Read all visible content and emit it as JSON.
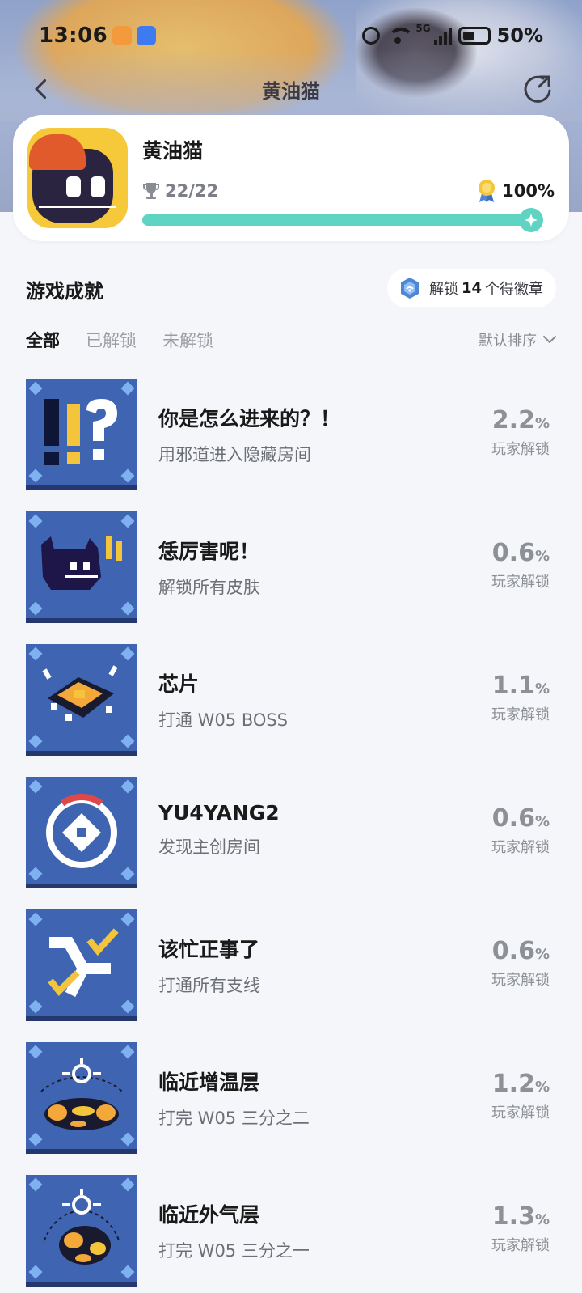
{
  "status": {
    "time": "13:06",
    "network": "5G",
    "battery": "50%"
  },
  "nav": {
    "title": "黄油猫"
  },
  "game": {
    "name": "黄油猫",
    "trophy_count": "22/22",
    "completion": "100%",
    "progress": 1.0
  },
  "section": {
    "title": "游戏成就",
    "unlock_prefix": "解锁",
    "unlock_count": "14",
    "unlock_suffix": "个得徽章"
  },
  "filters": {
    "tabs": [
      "全部",
      "已解锁",
      "未解锁"
    ],
    "active": 0,
    "sort_label": "默认排序"
  },
  "achievements": [
    {
      "title": "你是怎么进来的？！",
      "desc": "用邪道进入隐藏房间",
      "rate": "2.2",
      "pct": "%",
      "label": "玩家解锁",
      "icon": "exclaim-question-icon"
    },
    {
      "title": "恁厉害呢！",
      "desc": "解锁所有皮肤",
      "rate": "0.6",
      "pct": "%",
      "label": "玩家解锁",
      "icon": "cat-icon"
    },
    {
      "title": "芯片",
      "desc": "打通 W05 BOSS",
      "rate": "1.1",
      "pct": "%",
      "label": "玩家解锁",
      "icon": "chip-icon"
    },
    {
      "title": "YU4YANG2",
      "desc": "发现主创房间",
      "rate": "0.6",
      "pct": "%",
      "label": "玩家解锁",
      "icon": "dpad-icon"
    },
    {
      "title": "该忙正事了",
      "desc": "打通所有支线",
      "rate": "0.6",
      "pct": "%",
      "label": "玩家解锁",
      "icon": "check-path-icon"
    },
    {
      "title": "临近增温层",
      "desc": "打完 W05 三分之二",
      "rate": "1.2",
      "pct": "%",
      "label": "玩家解锁",
      "icon": "target-planet-icon"
    },
    {
      "title": "临近外气层",
      "desc": "打完 W05 三分之一",
      "rate": "1.3",
      "pct": "%",
      "label": "玩家解锁",
      "icon": "target-planet-small-icon"
    }
  ],
  "colors": {
    "accent": "#5fd4c2",
    "icon_bg": "#3e64b2",
    "icon_gold": "#f4c53a"
  }
}
